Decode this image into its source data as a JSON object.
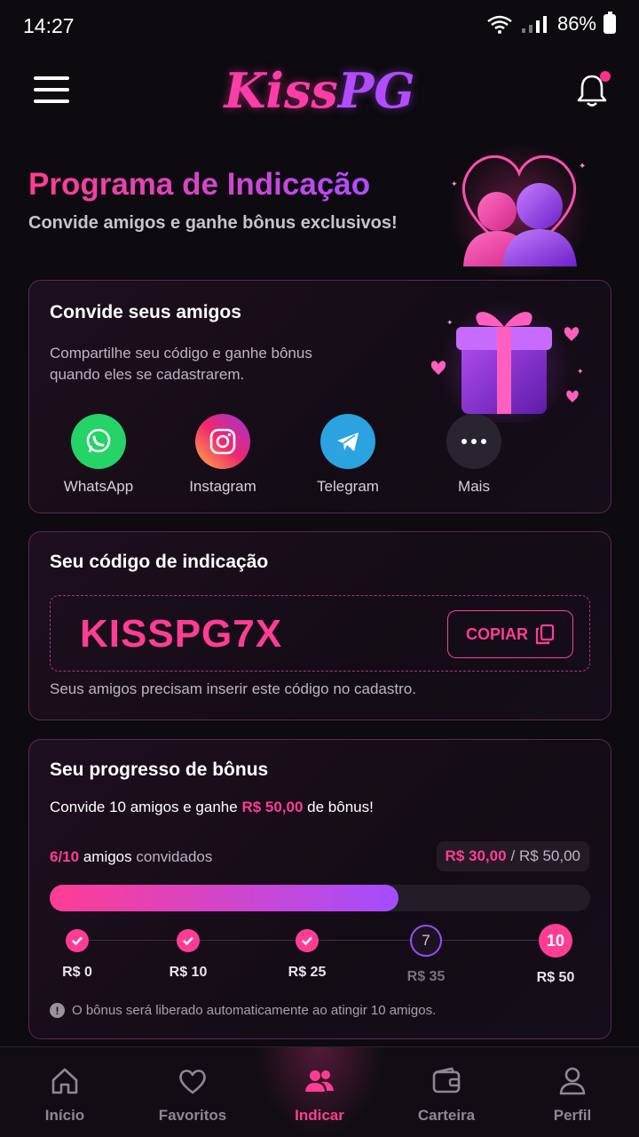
{
  "status_bar": {
    "time": "14:27",
    "battery": "86%"
  },
  "header": {
    "logo_part1": "Kiss",
    "logo_part2": "PG"
  },
  "hero": {
    "title": "Programa de Indicação",
    "subtitle": "Convide amigos e ganhe bônus exclusivos!"
  },
  "invite": {
    "title": "Convide seus amigos",
    "description": "Compartilhe seu código e ganhe bônus quando eles se cadastrarem.",
    "share_options": [
      {
        "label": "WhatsApp",
        "icon": "whatsapp-icon",
        "color": "#25d366"
      },
      {
        "label": "Instagram",
        "icon": "instagram-icon",
        "color": "#e1306c"
      },
      {
        "label": "Telegram",
        "icon": "telegram-icon",
        "color": "#2aa3e0"
      },
      {
        "label": "Mais",
        "icon": "more-icon",
        "color": "#2a2430"
      }
    ]
  },
  "referral": {
    "title": "Seu código de indicação",
    "code": "KISSPG7X",
    "copy_label": "COPIAR",
    "note": "Seus amigos precisam inserir este código no cadastro."
  },
  "progress": {
    "title": "Seu progresso de bônus",
    "goal_prefix": "Convide 10 amigos e ganhe ",
    "goal_amount": "R$ 50,00",
    "goal_suffix": " de bônus!",
    "invited_count": "6/10",
    "invited_word": "amigos",
    "invited_suffix": "convidados",
    "earned": "R$ 30,00",
    "total": "/ R$ 50,00",
    "fill_fraction": 0.645,
    "steps": [
      {
        "label": "R$ 0",
        "state": "done",
        "marker": ""
      },
      {
        "label": "R$ 10",
        "state": "done",
        "marker": ""
      },
      {
        "label": "R$ 25",
        "state": "done",
        "marker": ""
      },
      {
        "label": "R$ 35",
        "state": "pending",
        "marker": "7"
      },
      {
        "label": "R$ 50",
        "state": "final",
        "marker": "10"
      }
    ],
    "info_text": "O bônus será liberado automaticamente ao atingir 10 amigos."
  },
  "nav": {
    "items": [
      {
        "label": "Início",
        "icon": "home-icon"
      },
      {
        "label": "Favoritos",
        "icon": "heart-icon"
      },
      {
        "label": "Indicar",
        "icon": "users-icon"
      },
      {
        "label": "Carteira",
        "icon": "wallet-icon"
      },
      {
        "label": "Perfil",
        "icon": "profile-icon"
      }
    ],
    "active": "Indicar"
  },
  "colors": {
    "accent": "#ff3d94",
    "accent2": "#a44dff",
    "background": "#0d0a10"
  }
}
